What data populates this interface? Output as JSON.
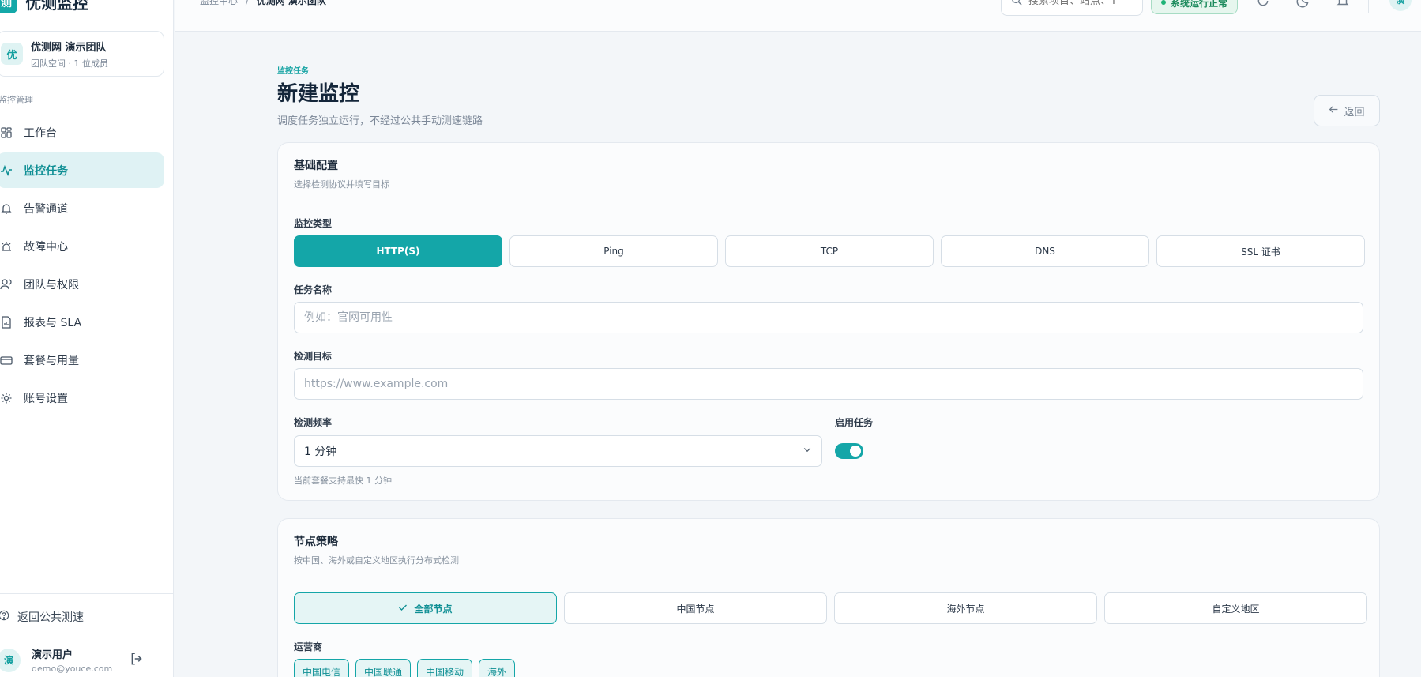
{
  "brand": {
    "logo_text": "测",
    "name": "优测监控"
  },
  "team": {
    "avatar": "优",
    "name": "优测网 演示团队",
    "subtitle": "团队空间 · 1 位成员"
  },
  "sidebar": {
    "section_label": "监控管理",
    "items": [
      {
        "label": "工作台",
        "icon": "dashboard-icon",
        "active": false
      },
      {
        "label": "监控任务",
        "icon": "activity-icon",
        "active": true
      },
      {
        "label": "告警通道",
        "icon": "bell-icon",
        "active": false
      },
      {
        "label": "故障中心",
        "icon": "siren-icon",
        "active": false
      },
      {
        "label": "团队与权限",
        "icon": "users-icon",
        "active": false
      },
      {
        "label": "报表与 SLA",
        "icon": "report-icon",
        "active": false
      },
      {
        "label": "套餐与用量",
        "icon": "card-icon",
        "active": false
      },
      {
        "label": "账号设置",
        "icon": "gear-icon",
        "active": false
      }
    ],
    "back_public": "返回公共测速",
    "user": {
      "avatar": "演",
      "name": "演示用户",
      "email": "demo@youce.com"
    }
  },
  "topbar": {
    "breadcrumb": {
      "parent": "监控中心",
      "separator": "/",
      "current": "优测网 演示团队"
    },
    "search_placeholder": "搜索项目、站点、T",
    "status": "系统运行正常",
    "avatar": "演"
  },
  "page": {
    "eyebrow": "监控任务",
    "title": "新建监控",
    "description": "调度任务独立运行，不经过公共手动测速链路",
    "back_label": "返回"
  },
  "basic": {
    "title": "基础配置",
    "subtitle": "选择检测协议并填写目标",
    "type_label": "监控类型",
    "types": [
      "HTTP(S)",
      "Ping",
      "TCP",
      "DNS",
      "SSL 证书"
    ],
    "selected_type": "HTTP(S)",
    "name_label": "任务名称",
    "name_placeholder": "例如：官网可用性",
    "target_label": "检测目标",
    "target_placeholder": "https://www.example.com",
    "freq_label": "检测频率",
    "freq_value": "1 分钟",
    "freq_hint": "当前套餐支持最快 1 分钟",
    "enable_label": "启用任务",
    "enabled": true
  },
  "nodes": {
    "title": "节点策略",
    "subtitle": "按中国、海外或自定义地区执行分布式检测",
    "strategies": [
      "全部节点",
      "中国节点",
      "海外节点",
      "自定义地区"
    ],
    "selected_strategy": "全部节点",
    "carrier_label": "运营商",
    "carriers": [
      "中国电信",
      "中国联通",
      "中国移动",
      "海外"
    ]
  },
  "colors": {
    "accent": "#14a6a8",
    "accent_soft": "#e5f5f5",
    "success": "#1fb377"
  }
}
